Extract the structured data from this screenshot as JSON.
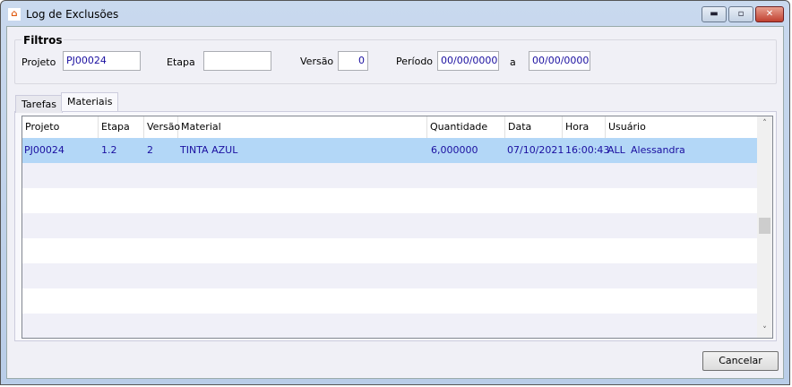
{
  "window": {
    "title": "Log de Exclusões",
    "app_icon": "app-logo-icon",
    "minimize": "minimize-icon",
    "maximize": "maximize-icon",
    "close": "close-icon"
  },
  "filters": {
    "group_label": "Filtros",
    "projeto_label": "Projeto",
    "projeto_value": "PJ00024",
    "etapa_label": "Etapa",
    "etapa_value": "",
    "versao_label": "Versão",
    "versao_value": "0",
    "periodo_label": "Período",
    "periodo_from": "00/00/0000",
    "a_label": "a",
    "periodo_to": "00/00/0000"
  },
  "tabs": [
    {
      "label": "Tarefas"
    },
    {
      "label": "Materiais",
      "active": true
    }
  ],
  "grid": {
    "columns": [
      "Projeto",
      "Etapa",
      "Versão",
      "Material",
      "Quantidade",
      "Data",
      "Hora",
      "Usuário"
    ],
    "rows": [
      [
        "PJ00024",
        "1.2",
        "2",
        "TINTA AZUL",
        "6,000000",
        "07/10/2021",
        "16:00:43",
        "ALL",
        "Alessandra"
      ]
    ],
    "selected_row_color": "#b3d7f7",
    "alt_row_color": "#f0f0f8"
  },
  "buttons": {
    "cancel": "Cancelar"
  }
}
